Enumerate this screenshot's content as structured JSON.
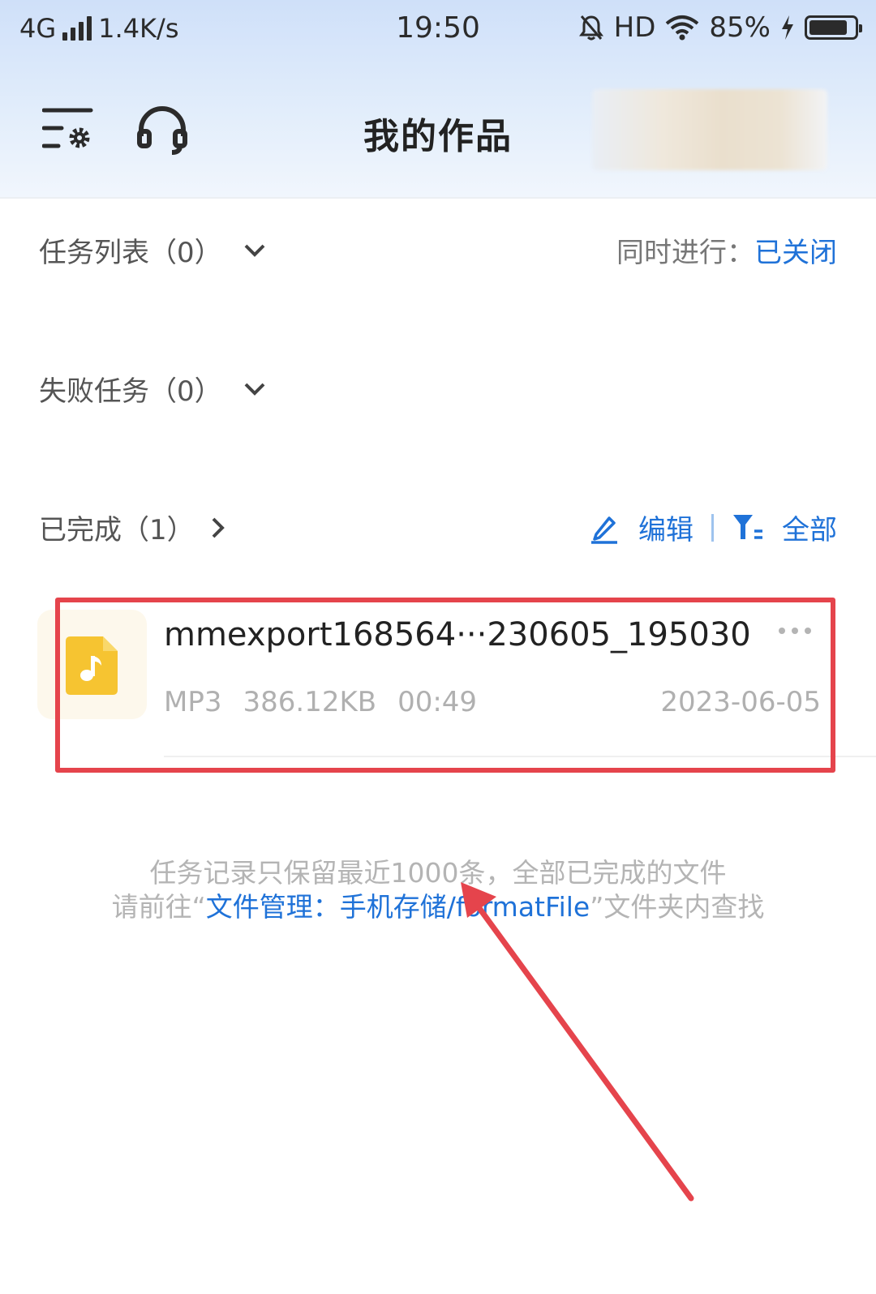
{
  "status_bar": {
    "network": "4G",
    "speed": "1.4K/s",
    "time": "19:50",
    "hd": "HD",
    "battery": "85%",
    "battery_level": 0.85,
    "icons": [
      "signal-icon",
      "mute-bell-icon",
      "wifi-icon",
      "charging-icon",
      "battery-icon"
    ]
  },
  "header": {
    "title": "我的作品",
    "icons": [
      "settings-menu-icon",
      "headset-icon"
    ]
  },
  "tasks": {
    "label": "任务列表（0）",
    "concurrent_label": "同时进行：",
    "concurrent_value": "已关闭"
  },
  "failed": {
    "label": "失败任务（0）"
  },
  "completed": {
    "label": "已完成（1）",
    "edit_label": "编辑",
    "filter_label": "全部"
  },
  "file": {
    "name": "mmexport168564···230605_195030",
    "format": "MP3",
    "size": "386.12KB",
    "duration": "00:49",
    "date": "2023-06-05"
  },
  "tip": {
    "line1": "任务记录只保留最近1000条，全部已完成的文件",
    "line2_pre": "请前往“",
    "line2_link": "文件管理：手机存储/formatFile",
    "line2_post": "”文件夹内查找"
  },
  "colors": {
    "accent": "#1f72d8",
    "highlight": "#e5444c",
    "file_icon": "#f6c431"
  }
}
